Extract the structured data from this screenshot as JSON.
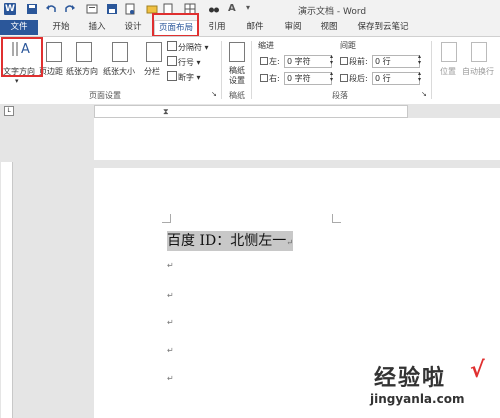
{
  "window": {
    "title": "演示文档 - Word"
  },
  "tabs": {
    "file": "文件",
    "home": "开始",
    "insert": "插入",
    "design": "设计",
    "layout": "页面布局",
    "references": "引用",
    "mailings": "邮件",
    "review": "审阅",
    "view": "视图",
    "save_cloud": "保存到云笔记"
  },
  "ribbon": {
    "text_direction": "文字方向",
    "margins": "页边距",
    "orientation": "纸张方向",
    "size": "纸张大小",
    "columns": "分栏",
    "breaks": "分隔符",
    "line_numbers": "行号",
    "hyphenation": "断字",
    "group_page_setup": "页面设置",
    "draft_paper": "稿纸设置",
    "group_draft": "稿纸",
    "indent_label": "缩进",
    "spacing_label": "间距",
    "indent_left_label": "左:",
    "indent_right_label": "右:",
    "indent_left_value": "0 字符",
    "indent_right_value": "0 字符",
    "before_label": "段前:",
    "after_label": "段后:",
    "before_value": "0 行",
    "after_value": "0 行",
    "group_paragraph": "段落",
    "position": "位置",
    "wrap_text": "自动换行"
  },
  "document": {
    "line1": "百度 ID：北恻左一",
    "paragraph_mark": "↵"
  },
  "watermark": {
    "text": "经验啦",
    "check": "√",
    "url": "jingyanla.com"
  },
  "colors": {
    "accent": "#2b579a",
    "highlight_box": "#e03030",
    "selection": "#c8c8c8"
  }
}
